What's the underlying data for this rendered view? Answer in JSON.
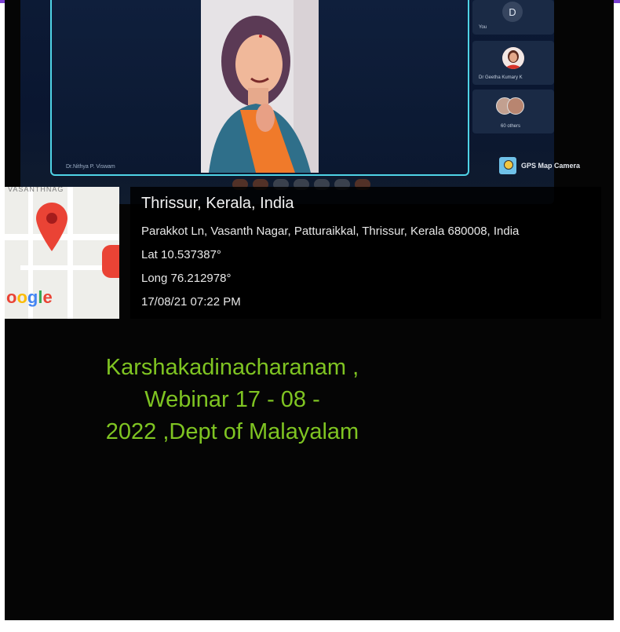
{
  "meeting": {
    "speaker_name": "Dr.Nithya P. Viswam",
    "participants": [
      {
        "initial": "D",
        "label": "You"
      },
      {
        "label": "Dr Geetha Kumary K"
      },
      {
        "label": "60 others"
      }
    ],
    "camera_badge": "GPS Map Camera"
  },
  "gps_overlay": {
    "map_corner_label": "VASANTHNAG",
    "map_logo": [
      "o",
      "o",
      "g",
      "l",
      "e"
    ],
    "location_title": "Thrissur, Kerala, India",
    "address": "Parakkot Ln, Vasanth Nagar, Patturaikkal, Thrissur, Kerala 680008, India",
    "lat": "Lat 10.537387°",
    "long": "Long 76.212978°",
    "datetime": "17/08/21 07:22 PM"
  },
  "caption": {
    "line1": "Karshakadinacharanam ,",
    "line2": "Webinar 17 - 08 -",
    "line3": "2022 ,Dept of Malayalam"
  },
  "colors": {
    "caption": "#7fc422",
    "screen_highlight": "#4fd3e6",
    "accent": "#7a3fd0"
  }
}
